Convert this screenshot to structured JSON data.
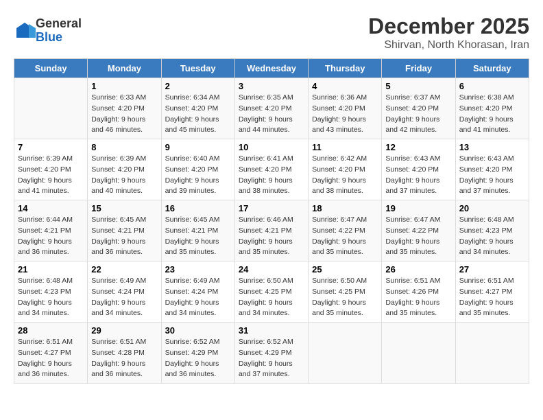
{
  "header": {
    "logo_general": "General",
    "logo_blue": "Blue",
    "title": "December 2025",
    "subtitle": "Shirvan, North Khorasan, Iran"
  },
  "days_of_week": [
    "Sunday",
    "Monday",
    "Tuesday",
    "Wednesday",
    "Thursday",
    "Friday",
    "Saturday"
  ],
  "weeks": [
    [
      {
        "day": "",
        "info": ""
      },
      {
        "day": "1",
        "info": "Sunrise: 6:33 AM\nSunset: 4:20 PM\nDaylight: 9 hours\nand 46 minutes."
      },
      {
        "day": "2",
        "info": "Sunrise: 6:34 AM\nSunset: 4:20 PM\nDaylight: 9 hours\nand 45 minutes."
      },
      {
        "day": "3",
        "info": "Sunrise: 6:35 AM\nSunset: 4:20 PM\nDaylight: 9 hours\nand 44 minutes."
      },
      {
        "day": "4",
        "info": "Sunrise: 6:36 AM\nSunset: 4:20 PM\nDaylight: 9 hours\nand 43 minutes."
      },
      {
        "day": "5",
        "info": "Sunrise: 6:37 AM\nSunset: 4:20 PM\nDaylight: 9 hours\nand 42 minutes."
      },
      {
        "day": "6",
        "info": "Sunrise: 6:38 AM\nSunset: 4:20 PM\nDaylight: 9 hours\nand 41 minutes."
      }
    ],
    [
      {
        "day": "7",
        "info": "Sunrise: 6:39 AM\nSunset: 4:20 PM\nDaylight: 9 hours\nand 41 minutes."
      },
      {
        "day": "8",
        "info": "Sunrise: 6:39 AM\nSunset: 4:20 PM\nDaylight: 9 hours\nand 40 minutes."
      },
      {
        "day": "9",
        "info": "Sunrise: 6:40 AM\nSunset: 4:20 PM\nDaylight: 9 hours\nand 39 minutes."
      },
      {
        "day": "10",
        "info": "Sunrise: 6:41 AM\nSunset: 4:20 PM\nDaylight: 9 hours\nand 38 minutes."
      },
      {
        "day": "11",
        "info": "Sunrise: 6:42 AM\nSunset: 4:20 PM\nDaylight: 9 hours\nand 38 minutes."
      },
      {
        "day": "12",
        "info": "Sunrise: 6:43 AM\nSunset: 4:20 PM\nDaylight: 9 hours\nand 37 minutes."
      },
      {
        "day": "13",
        "info": "Sunrise: 6:43 AM\nSunset: 4:20 PM\nDaylight: 9 hours\nand 37 minutes."
      }
    ],
    [
      {
        "day": "14",
        "info": "Sunrise: 6:44 AM\nSunset: 4:21 PM\nDaylight: 9 hours\nand 36 minutes."
      },
      {
        "day": "15",
        "info": "Sunrise: 6:45 AM\nSunset: 4:21 PM\nDaylight: 9 hours\nand 36 minutes."
      },
      {
        "day": "16",
        "info": "Sunrise: 6:45 AM\nSunset: 4:21 PM\nDaylight: 9 hours\nand 35 minutes."
      },
      {
        "day": "17",
        "info": "Sunrise: 6:46 AM\nSunset: 4:21 PM\nDaylight: 9 hours\nand 35 minutes."
      },
      {
        "day": "18",
        "info": "Sunrise: 6:47 AM\nSunset: 4:22 PM\nDaylight: 9 hours\nand 35 minutes."
      },
      {
        "day": "19",
        "info": "Sunrise: 6:47 AM\nSunset: 4:22 PM\nDaylight: 9 hours\nand 35 minutes."
      },
      {
        "day": "20",
        "info": "Sunrise: 6:48 AM\nSunset: 4:23 PM\nDaylight: 9 hours\nand 34 minutes."
      }
    ],
    [
      {
        "day": "21",
        "info": "Sunrise: 6:48 AM\nSunset: 4:23 PM\nDaylight: 9 hours\nand 34 minutes."
      },
      {
        "day": "22",
        "info": "Sunrise: 6:49 AM\nSunset: 4:24 PM\nDaylight: 9 hours\nand 34 minutes."
      },
      {
        "day": "23",
        "info": "Sunrise: 6:49 AM\nSunset: 4:24 PM\nDaylight: 9 hours\nand 34 minutes."
      },
      {
        "day": "24",
        "info": "Sunrise: 6:50 AM\nSunset: 4:25 PM\nDaylight: 9 hours\nand 34 minutes."
      },
      {
        "day": "25",
        "info": "Sunrise: 6:50 AM\nSunset: 4:25 PM\nDaylight: 9 hours\nand 35 minutes."
      },
      {
        "day": "26",
        "info": "Sunrise: 6:51 AM\nSunset: 4:26 PM\nDaylight: 9 hours\nand 35 minutes."
      },
      {
        "day": "27",
        "info": "Sunrise: 6:51 AM\nSunset: 4:27 PM\nDaylight: 9 hours\nand 35 minutes."
      }
    ],
    [
      {
        "day": "28",
        "info": "Sunrise: 6:51 AM\nSunset: 4:27 PM\nDaylight: 9 hours\nand 36 minutes."
      },
      {
        "day": "29",
        "info": "Sunrise: 6:51 AM\nSunset: 4:28 PM\nDaylight: 9 hours\nand 36 minutes."
      },
      {
        "day": "30",
        "info": "Sunrise: 6:52 AM\nSunset: 4:29 PM\nDaylight: 9 hours\nand 36 minutes."
      },
      {
        "day": "31",
        "info": "Sunrise: 6:52 AM\nSunset: 4:29 PM\nDaylight: 9 hours\nand 37 minutes."
      },
      {
        "day": "",
        "info": ""
      },
      {
        "day": "",
        "info": ""
      },
      {
        "day": "",
        "info": ""
      }
    ]
  ]
}
